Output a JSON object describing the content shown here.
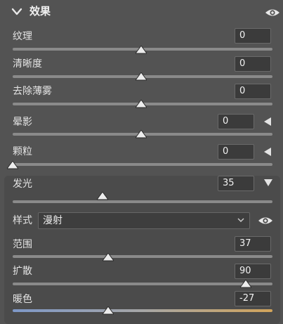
{
  "section": {
    "title": "效果"
  },
  "sliders": [
    {
      "label": "纹理",
      "value": "0",
      "level": 0.5
    },
    {
      "label": "清晰度",
      "value": "0",
      "level": 0.5
    },
    {
      "label": "去除薄雾",
      "value": "0",
      "level": 0.5
    },
    {
      "label": "晕影",
      "value": "0",
      "level": 0.5
    },
    {
      "label": "颗粒",
      "value": "0",
      "level": 0.0
    }
  ],
  "glow": {
    "label": "发光",
    "value": "35",
    "level": 0.35
  },
  "style": {
    "label": "样式",
    "selected": "漫射"
  },
  "sub_sliders": [
    {
      "label": "范围",
      "value": "37",
      "level": 0.37
    },
    {
      "label": "扩散",
      "value": "90",
      "level": 0.9
    },
    {
      "label": "暖色",
      "value": "-27",
      "level": 0.37
    }
  ],
  "icons": {
    "collapse": "chevron-down-icon",
    "visibility": "eye-icon",
    "expand_left": "triangle-left-icon",
    "expand_down": "triangle-down-icon"
  }
}
